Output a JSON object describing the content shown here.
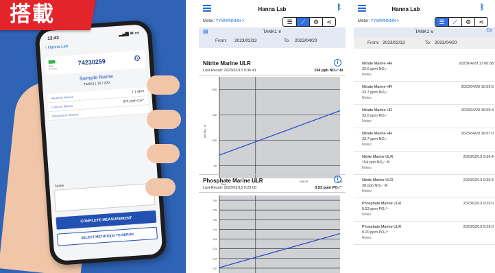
{
  "promo": {
    "ribbon_text": "搭載",
    "phone": {
      "time": "12:43",
      "signal": "▂▄▆ ≋ ▭",
      "back_label": "Hanna Lab",
      "battery_label": "86%",
      "meter_small": "477 hrs",
      "meter_number": "74230259",
      "sample_name": "Sample Name",
      "tank_line": "TANK1 | 16 / 200",
      "methods": [
        {
          "name": "Alkalinity Marine",
          "value": "7.1 dKH"
        },
        {
          "name": "Calcium Marine",
          "value": "374 ppm Ca²⁺"
        },
        {
          "name": "Magnesium Marine",
          "value": ""
        }
      ],
      "notes_label": "Notes",
      "complete_button": "COMPLETE MEASUREMENT",
      "rerun_button": "SELECT METHOD(S) TO RERUN"
    }
  },
  "graph_screen": {
    "header_title": "Hanna Lab",
    "meter_label": "Meter:",
    "meter_value": "YYWWNNNN >",
    "tank": "TANK1 ∨",
    "from_label": "From:",
    "from_date": "2023/02/13",
    "to_label": "To:",
    "to_date": "2023/04/20",
    "chart1": {
      "title": "Nitrite Marine ULR",
      "last_result": "Last Result: 2023/02/13 9:36:41",
      "last_value": "154 ppb NO₂⁻-N"
    },
    "chart2": {
      "title": "Phosphate Marine ULR",
      "last_result": "Last Result: 2023/02/13 9:29:00",
      "last_value": "0.53 ppm PO₄³⁻"
    }
  },
  "list_screen": {
    "header_title": "Hanna Lab",
    "meter_label": "Meter:",
    "meter_value": "YYWWNNNN >",
    "tank": "TANK1 ∨",
    "edit_label": "Edi",
    "from_label": "From:",
    "from_date": "2023/02/13",
    "to_label": "To:",
    "to_date": "2023/04/20",
    "rows": [
      {
        "name": "Nitrate Marine HR",
        "result": "33.6 ppm NO₃⁻",
        "notes": "Notes:",
        "time": "2023/04/20 17:00:38"
      },
      {
        "name": "Nitrate Marine HR",
        "result": "33.7 ppm NO₃⁻",
        "notes": "Notes:",
        "time": "2023/04/20 16:59:5"
      },
      {
        "name": "Nitrate Marine HR",
        "result": "33.6 ppm NO₃⁻",
        "notes": "Notes:",
        "time": "2023/04/20 16:59:4"
      },
      {
        "name": "Nitrate Marine HR",
        "result": "33.7 ppm NO₃⁻",
        "notes": "Notes:",
        "time": "2023/04/20 16:57:0"
      },
      {
        "name": "Nitrite Marine ULR",
        "result": "154 ppb NO₂⁻-N",
        "notes": "Notes:",
        "time": "2023/02/13 9:36:4"
      },
      {
        "name": "Nitrite Marine ULR",
        "result": "38 ppb NO₂⁻-N",
        "notes": "Notes:",
        "time": "2023/02/13 9:36:3"
      },
      {
        "name": "Phosphate Marine ULR",
        "result": "0.53 ppm PO₄³⁻",
        "notes": "Notes:",
        "time": "2023/02/13 9:29:0"
      },
      {
        "name": "Phosphate Marine ULR",
        "result": "0.20 ppm PO₄³⁻",
        "notes": "Notes:",
        "time": "2023/02/13 9:29:0"
      }
    ]
  },
  "chart_data": [
    {
      "type": "line",
      "ylabel": "ppb NO₂⁻-N",
      "xlabel": "Time",
      "yticks": [
        "200",
        "150",
        "100",
        "50"
      ],
      "xticks": [
        "9:36:37",
        "9:36:39",
        "9:36:"
      ],
      "series": [
        {
          "x": [
            0,
            1
          ],
          "values": [
            55,
            160
          ]
        }
      ],
      "ylim": [
        0,
        240
      ]
    },
    {
      "type": "line",
      "yticks": [
        "0.6",
        "0.5",
        "0.5",
        "0.4",
        "0.4",
        "0.3",
        "0.3",
        "0.2"
      ],
      "series": [
        {
          "x": [
            0,
            1
          ],
          "values": [
            0.14,
            0.39
          ]
        }
      ],
      "ylim": [
        0.1,
        0.67
      ]
    }
  ],
  "colors": {
    "accent": "#1b6ad8",
    "promo_bg": "#2f63b6",
    "ribbon": "#e3242b",
    "plot_bg": "#cfd1d4",
    "line": "#2f4fc9"
  }
}
